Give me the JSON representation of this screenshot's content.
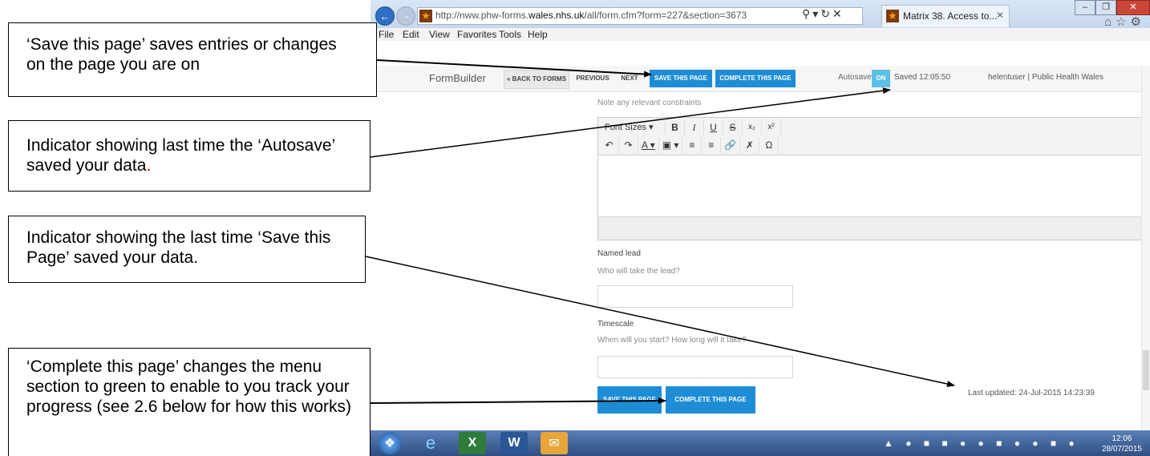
{
  "browser": {
    "url_prefix": "http://nww.phw-forms.",
    "url_domain": "wales.nhs.uk",
    "url_suffix": "/all/form.cfm?form=227&section=3673",
    "tab_title": "Matrix 38. Access to...",
    "menu": [
      "File",
      "Edit",
      "View",
      "Favorites",
      "Tools",
      "Help"
    ]
  },
  "appbar": {
    "brand": "FormBuilder",
    "back_label": "« BACK TO FORMS",
    "previous_label": "PREVIOUS",
    "next_label": "NEXT",
    "save_label": "SAVE THIS PAGE",
    "complete_label": "COMPLETE THIS PAGE",
    "autosave_label": "Autosave is",
    "autosave_state": "ON",
    "autosave_time": "Saved 12:05:50",
    "user": "helentuser | Public Health Wales"
  },
  "form": {
    "constraints_hint": "Note any relevant constraints",
    "editor_font_sizes": "Font Sizes",
    "named_lead_label": "Named lead",
    "named_lead_hint": "Who will take the lead?",
    "named_lead_value": "",
    "timescale_label": "Timescale",
    "timescale_hint": "When will you start? How long will it take?",
    "timescale_value": "",
    "bottom_save_label": "SAVE THIS PAGE",
    "bottom_complete_label": "COMPLETE THIS PAGE",
    "last_updated": "Last updated: 24-Jul-2015 14:23:39"
  },
  "taskbar": {
    "time": "12:06",
    "date": "28/07/2015"
  },
  "callouts": {
    "save_text": "‘Save this page’ saves entries or changes on the page you are on",
    "autosave_text": "Indicator showing last time the ‘Autosave’ saved your data",
    "autosave_period": ".",
    "last_saved_text": "Indicator showing the last time ‘Save this Page’ saved your data.",
    "complete_text": "‘Complete this page’ changes the menu section to green to enable to you track your progress (see 2.6 below for how this works)"
  },
  "colors": {
    "button_blue": "#1f8dd6",
    "autosave_on": "#5bc0e6",
    "taskbar": "#2e4f82"
  }
}
